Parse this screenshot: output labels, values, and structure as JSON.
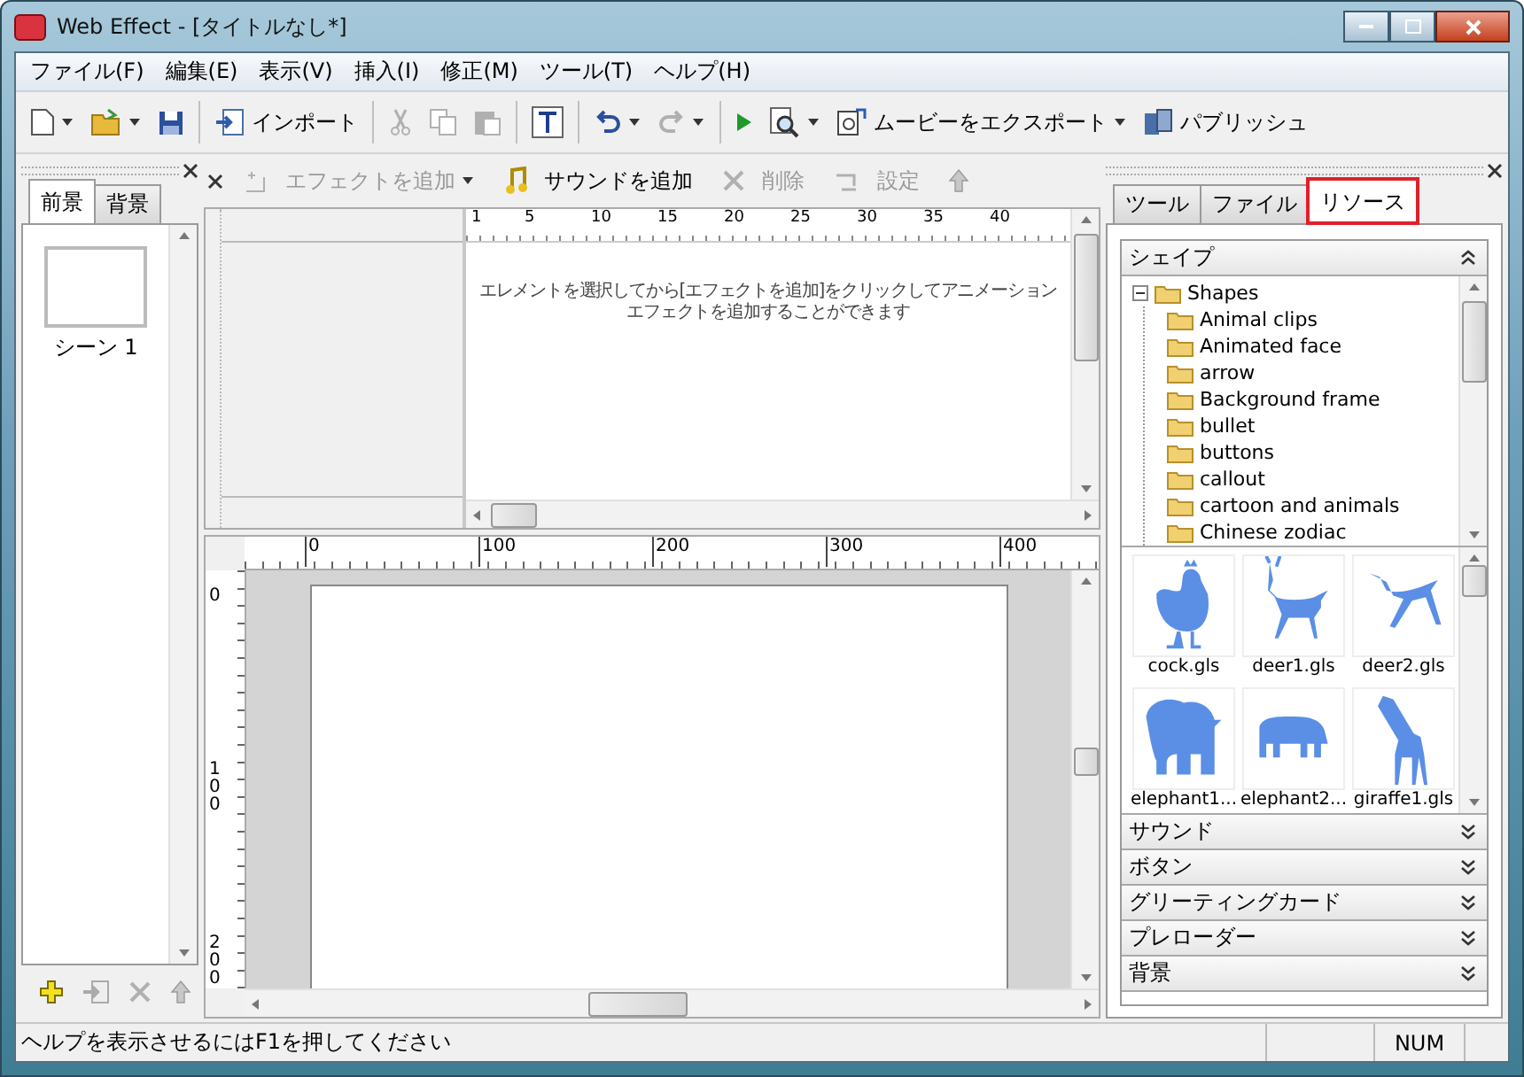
{
  "window": {
    "title": "Web Effect - [タイトルなし*]"
  },
  "menu": [
    {
      "label": "ファイル(F)"
    },
    {
      "label": "編集(E)"
    },
    {
      "label": "表示(V)"
    },
    {
      "label": "挿入(I)"
    },
    {
      "label": "修正(M)"
    },
    {
      "label": "ツール(T)"
    },
    {
      "label": "ヘルプ(H)"
    }
  ],
  "toolbar": [
    {
      "kind": "new",
      "dropdown": true,
      "disabled": false
    },
    {
      "kind": "open",
      "dropdown": true,
      "disabled": false
    },
    {
      "kind": "save",
      "disabled": false
    },
    {
      "kind": "separator"
    },
    {
      "kind": "import",
      "label": "インポート",
      "disabled": false
    },
    {
      "kind": "separator"
    },
    {
      "kind": "cut",
      "disabled": true
    },
    {
      "kind": "copy",
      "disabled": true
    },
    {
      "kind": "paste",
      "disabled": true
    },
    {
      "kind": "separator"
    },
    {
      "kind": "text",
      "disabled": false
    },
    {
      "kind": "separator"
    },
    {
      "kind": "undo",
      "dropdown": true,
      "disabled": false
    },
    {
      "kind": "redo",
      "dropdown": true,
      "disabled": true
    },
    {
      "kind": "separator"
    },
    {
      "kind": "play",
      "disabled": false
    },
    {
      "kind": "preview",
      "dropdown": true,
      "disabled": false
    },
    {
      "kind": "export",
      "label": "ムービーをエクスポート",
      "dropdown": true,
      "disabled": false
    },
    {
      "kind": "publish",
      "label": "パブリッシュ",
      "disabled": false
    }
  ],
  "left_panel": {
    "tabs": [
      {
        "label": "前景",
        "selected": true
      },
      {
        "label": "背景",
        "selected": false
      }
    ],
    "scenes": [
      {
        "label": "シーン 1",
        "selected": false
      }
    ],
    "actions": [
      {
        "kind": "add",
        "disabled": false
      },
      {
        "kind": "import",
        "disabled": true
      },
      {
        "kind": "delete",
        "disabled": true
      },
      {
        "kind": "move-up",
        "disabled": true
      }
    ]
  },
  "timeline": {
    "toolbar": [
      {
        "kind": "add-effect",
        "label": "エフェクトを追加",
        "dropdown": true,
        "disabled": true
      },
      {
        "kind": "add-sound",
        "label": "サウンドを追加",
        "disabled": false
      },
      {
        "kind": "delete",
        "label": "削除",
        "disabled": true
      },
      {
        "kind": "settings",
        "label": "設定",
        "disabled": true
      },
      {
        "kind": "move-up",
        "disabled": true
      }
    ],
    "ruler": [
      "1",
      "5",
      "10",
      "15",
      "20",
      "25",
      "30",
      "35",
      "40"
    ],
    "message_lines": [
      "エレメントを選択してから[エフェクトを追加]をクリックしてアニメーション",
      "エフェクトを追加することができます"
    ]
  },
  "canvas": {
    "h_ruler": [
      "0",
      "100",
      "200",
      "300",
      "400"
    ],
    "v_ruler": [
      "0",
      "100",
      "200"
    ]
  },
  "right_panel": {
    "tabs": [
      {
        "label": "ツール",
        "selected": false
      },
      {
        "label": "ファイル",
        "selected": false
      },
      {
        "label": "リソース",
        "selected": true
      }
    ],
    "sections": [
      {
        "title": "シェイプ",
        "expanded": true,
        "tree": [
          {
            "label": "Shapes",
            "expanded": true,
            "children": [
              {
                "label": "Animal clips"
              },
              {
                "label": "Animated face"
              },
              {
                "label": "arrow"
              },
              {
                "label": "Background frame"
              },
              {
                "label": "bullet"
              },
              {
                "label": "buttons"
              },
              {
                "label": "callout"
              },
              {
                "label": "cartoon and animals"
              },
              {
                "label": "Chinese zodiac"
              }
            ]
          }
        ],
        "items": [
          {
            "label": "cock.gls",
            "kind": "bird"
          },
          {
            "label": "deer1.gls",
            "kind": "deer"
          },
          {
            "label": "deer2.gls",
            "kind": "deer-running"
          },
          {
            "label": "elephant1...",
            "kind": "elephant"
          },
          {
            "label": "elephant2...",
            "kind": "rhino"
          },
          {
            "label": "giraffe1.gls",
            "kind": "giraffe"
          }
        ]
      },
      {
        "title": "サウンド",
        "expanded": false
      },
      {
        "title": "ボタン",
        "expanded": false
      },
      {
        "title": "グリーティングカード",
        "expanded": false
      },
      {
        "title": "プレローダー",
        "expanded": false
      },
      {
        "title": "背景",
        "expanded": false
      }
    ]
  },
  "status_bar": {
    "text": "ヘルプを表示させるにはF1を押してください",
    "indicator": "NUM"
  }
}
